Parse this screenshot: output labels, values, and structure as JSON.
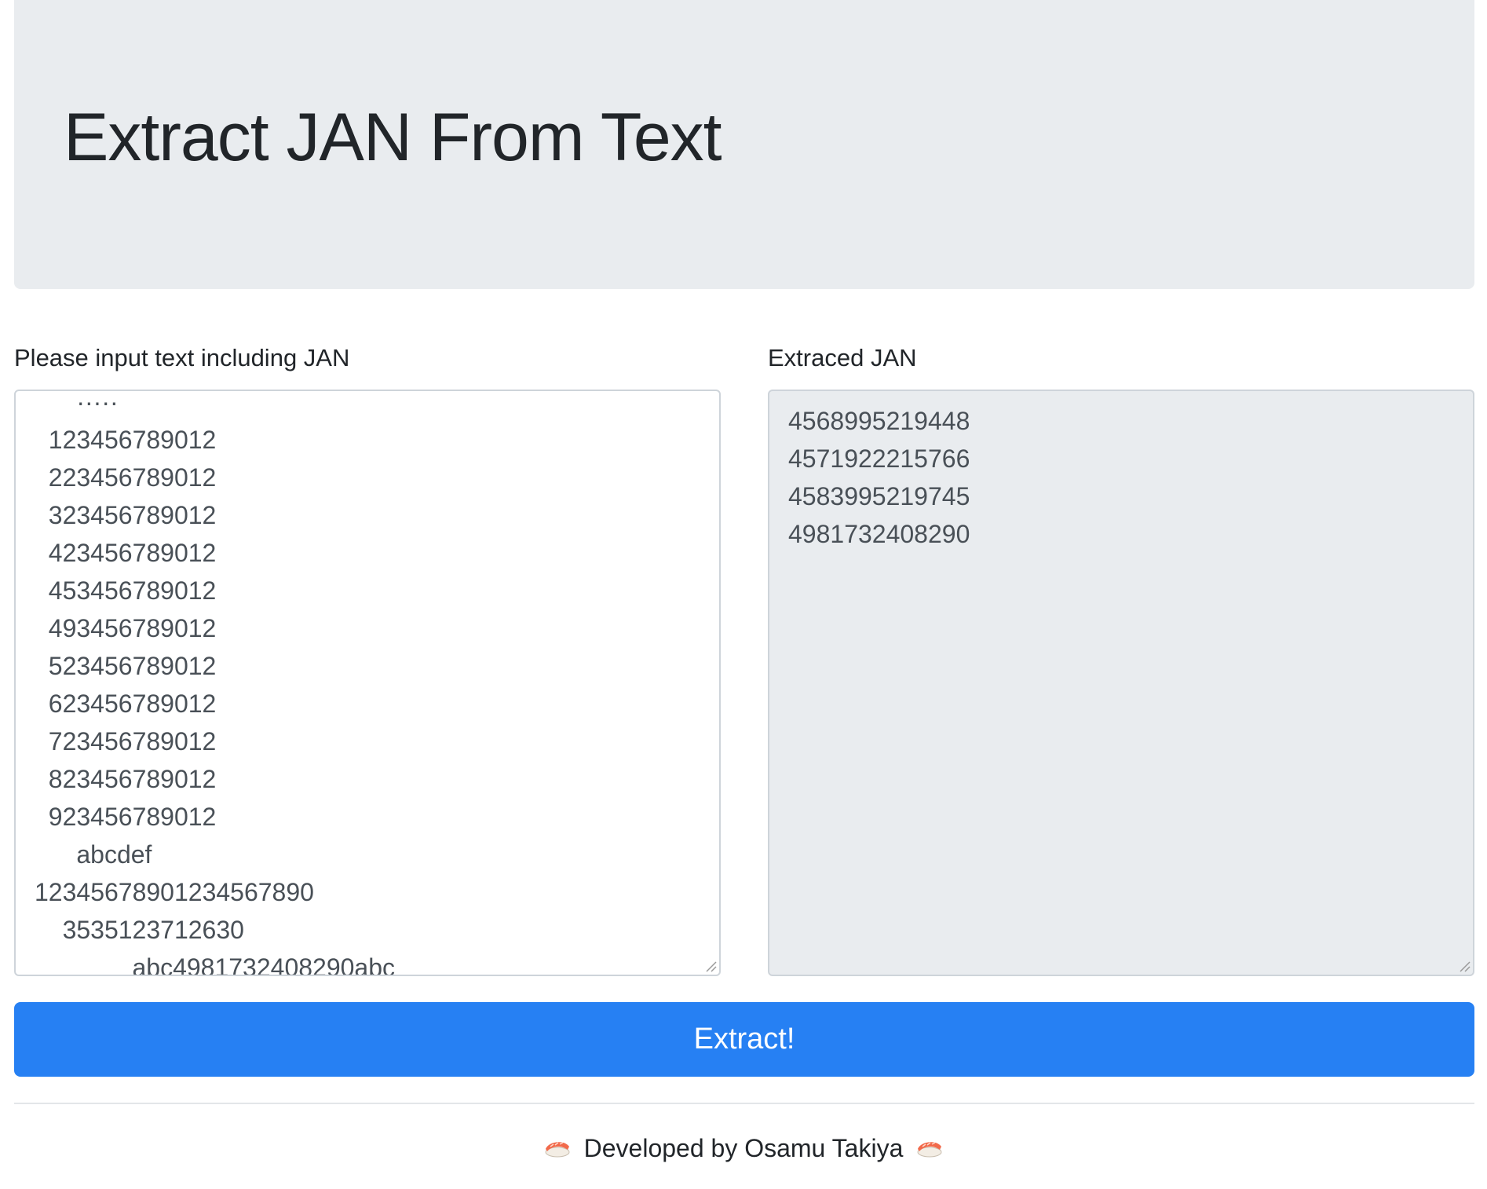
{
  "header": {
    "title": "Extract JAN From Text"
  },
  "input": {
    "label": "Please input text including JAN",
    "value": "      ·····\n  123456789012\n  223456789012\n  323456789012\n  423456789012\n  453456789012\n  493456789012\n  523456789012\n  623456789012\n  723456789012\n  823456789012\n  923456789012\n      abcdef\n12345678901234567890\n    3535123712630\n              abc4981732408290abc"
  },
  "output": {
    "label": "Extraced JAN",
    "value": "4568995219448\n4571922215766\n4583995219745\n4981732408290"
  },
  "actions": {
    "extract_label": "Extract!"
  },
  "footer": {
    "text": "Developed by Osamu Takiya",
    "icon": "sushi-icon"
  },
  "colors": {
    "jumbotron_bg": "#e9ecef",
    "primary": "#2680f3",
    "readonly_bg": "#e9ecef",
    "border": "#ced4da"
  }
}
